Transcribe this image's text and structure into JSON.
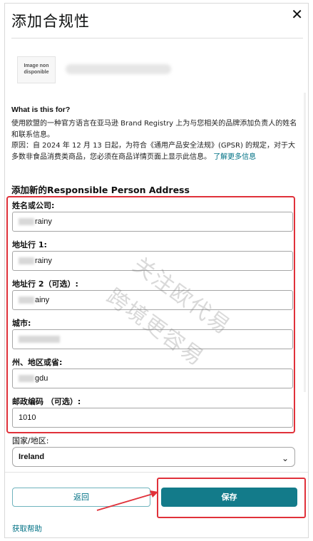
{
  "modal": {
    "title": "添加合规性",
    "close_icon": "✕"
  },
  "brand": {
    "thumb_text": "Image non disponible"
  },
  "info": {
    "heading": "What is this for?",
    "line1": "使用欧盟的一种官方语言在亚马逊 Brand Registry 上为与您相关的品牌添加负责人的姓名和联系信息。",
    "line2": "原因：自 2024 年 12 月 13 日起，为符合《通用产品安全法规》(GPSR) 的规定，对于大多数非食品消费类商品，您必须在商品详情页面上显示此信息。",
    "learn_more": "了解更多信息"
  },
  "form": {
    "section_title": "添加新的Responsible Person Address",
    "fields": [
      {
        "label": "姓名或公司:",
        "value": "rainy"
      },
      {
        "label": "地址行 1:",
        "value": "rainy"
      },
      {
        "label": "地址行 2（可选）:",
        "value": "ainy"
      },
      {
        "label": "城市:",
        "value": ""
      },
      {
        "label": "州、地区或省:",
        "value": "gdu"
      },
      {
        "label": "邮政编码 （可选）:",
        "value": "1010"
      }
    ],
    "country_label": "国家/地区:",
    "country_value": "Ireland"
  },
  "actions": {
    "back_label": "返回",
    "save_label": "保存",
    "help_label": "获取帮助"
  },
  "watermark": {
    "line1": "关注欧代易",
    "line2": "跨境更容易"
  },
  "colors": {
    "annotation_red": "#e0313a",
    "primary": "#137b8a",
    "link": "#007185"
  }
}
